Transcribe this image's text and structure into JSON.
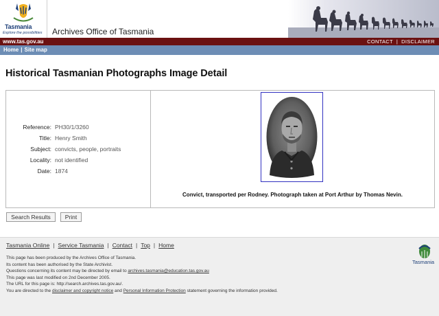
{
  "header": {
    "logo_word": "Tasmania",
    "logo_tagline": "Explore the possibilities",
    "site_title": "Archives Office of Tasmania"
  },
  "redbar": {
    "url": "www.tas.gov.au",
    "contact": "CONTACT",
    "separator": "|",
    "disclaimer": "DISCLAIMER"
  },
  "nav": {
    "home": "Home",
    "separator": "|",
    "sitemap": "Site map"
  },
  "page": {
    "title": "Historical Tasmanian Photographs Image Detail"
  },
  "record": {
    "fields": [
      {
        "label": "Reference:",
        "value": "PH30/1/3260"
      },
      {
        "label": "Title:",
        "value": "Henry Smith"
      },
      {
        "label": "Subject:",
        "value": "convicts, people, portraits"
      },
      {
        "label": "Locality:",
        "value": "not identified"
      },
      {
        "label": "Date:",
        "value": "1874"
      }
    ],
    "caption": "Convict, transported per Rodney. Photograph taken at Port Arthur by Thomas Nevin."
  },
  "buttons": {
    "search_results": "Search Results",
    "print": "Print"
  },
  "footer": {
    "links": [
      "Tasmania Online",
      "Service Tasmania",
      "Contact",
      "Top",
      "Home"
    ],
    "separator": "|",
    "line1": "This page has been produced by the Archives Office of Tasmania.",
    "line2": "Its content has been authorised by the State Archivist.",
    "line3_prefix": "Questions concerning its content may be directed by email to ",
    "line3_email": "archives.tasmania@education.tas.gov.au",
    "line4": "This page was last modified on 2nd December 2005.",
    "line5": "The URL for this page is: http://search.archives.tas.gov.au/.",
    "line6_prefix": "You are directed to the ",
    "line6_link1": "disclaimer and copyright notice",
    "line6_mid": " and ",
    "line6_link2": "Personal Information Protection",
    "line6_suffix": " statement governing the information provided.",
    "logo_word": "Tasmania"
  }
}
